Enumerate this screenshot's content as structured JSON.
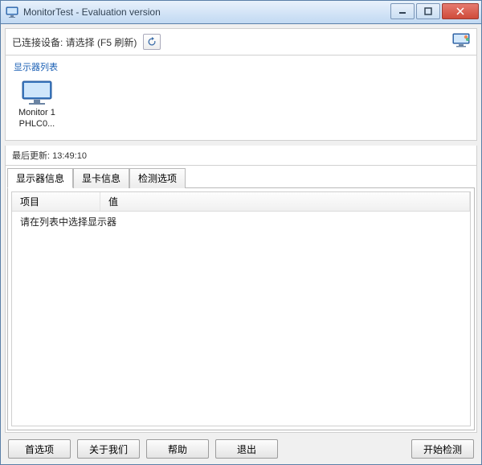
{
  "window": {
    "title": "MonitorTest - Evaluation version"
  },
  "toolbar": {
    "connected_label": "已连接设备: 请选择 (F5 刷新)"
  },
  "monitor_list": {
    "group_title": "显示器列表",
    "items": [
      {
        "line1": "Monitor 1",
        "line2": "PHLC0..."
      }
    ]
  },
  "update": {
    "label": "最后更新:",
    "time": "13:49:10"
  },
  "tabs": {
    "t0": "显示器信息",
    "t1": "显卡信息",
    "t2": "检测选项"
  },
  "listview": {
    "col_item": "项目",
    "col_value": "值",
    "empty_message": "请在列表中选择显示器"
  },
  "buttons": {
    "prefs": "首选项",
    "about": "关于我们",
    "help": "帮助",
    "exit": "退出",
    "start": "开始检测"
  }
}
